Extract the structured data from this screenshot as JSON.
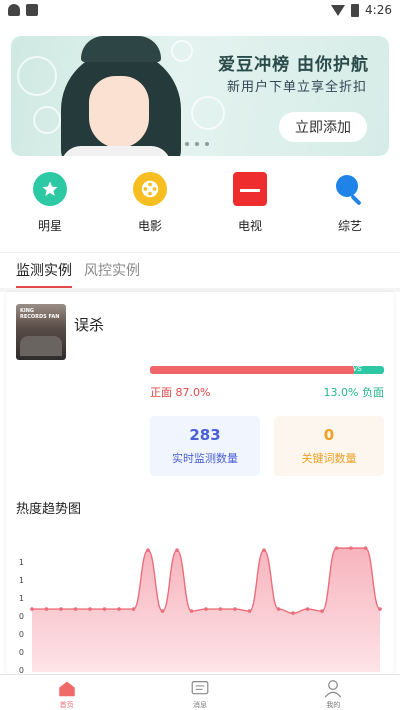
{
  "status_bar": {
    "time": "4:26"
  },
  "banner": {
    "title": "爱豆冲榜 由你护航",
    "subtitle": "新用户下单立享全折扣",
    "button_label": "立即添加"
  },
  "categories": [
    {
      "label": "明星",
      "icon": "star-icon",
      "color": "#2dc9a4"
    },
    {
      "label": "电影",
      "icon": "film-reel-icon",
      "color": "#f7be22"
    },
    {
      "label": "电视",
      "icon": "tv-icon",
      "color": "#ee2e2e"
    },
    {
      "label": "综艺",
      "icon": "microphone-icon",
      "color": "#1f83e8"
    }
  ],
  "tabs": [
    {
      "label": "监测实例",
      "active": true
    },
    {
      "label": "风控实例",
      "active": false
    }
  ],
  "card": {
    "poster_text": "KING RECORDS FAN",
    "movie_title": "误杀",
    "sentiment": {
      "positive_label": "正面 87.0%",
      "negative_label": "13.0% 负面",
      "positive_fraction": 0.87,
      "vs_label": "VS"
    },
    "stats": [
      {
        "value": "283",
        "label": "实时监测数量"
      },
      {
        "value": "0",
        "label": "关键词数量"
      }
    ],
    "chart_title": "热度趋势图"
  },
  "chart_data": {
    "type": "area",
    "title": "热度趋势图",
    "y_tick_labels": [
      "1",
      "1",
      "1",
      "0",
      "0",
      "0",
      "0"
    ],
    "values": [
      0.62,
      0.62,
      0.62,
      0.62,
      0.62,
      0.62,
      0.62,
      0.62,
      1.2,
      0.6,
      1.2,
      0.6,
      0.62,
      0.62,
      0.62,
      0.6,
      1.2,
      0.62,
      0.58,
      0.62,
      0.6,
      1.22,
      1.22,
      1.22,
      0.62
    ],
    "ylim": [
      0,
      1.3
    ],
    "line_color": "#ec6e7c",
    "fill_color": "#f7b4bd"
  },
  "tab_bar": [
    {
      "label": "首页",
      "icon": "home-icon",
      "active": true
    },
    {
      "label": "消息",
      "icon": "message-icon",
      "active": false
    },
    {
      "label": "我的",
      "icon": "profile-icon",
      "active": false
    }
  ]
}
